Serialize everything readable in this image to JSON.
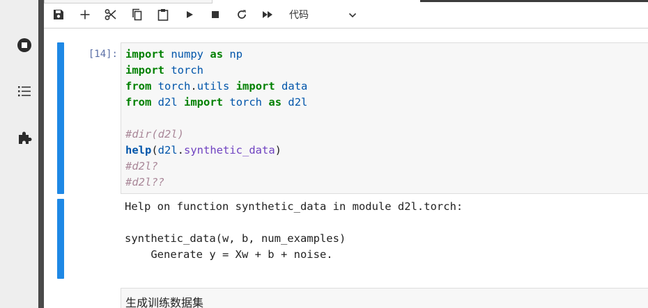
{
  "sidebar": {
    "items": [
      {
        "icon": "stop-circle-icon"
      },
      {
        "icon": "list-icon"
      },
      {
        "icon": "puzzle-piece-icon"
      }
    ]
  },
  "toolbar": {
    "buttons": [
      {
        "icon": "save-icon"
      },
      {
        "icon": "plus-icon"
      },
      {
        "icon": "scissors-icon"
      },
      {
        "icon": "copy-icon"
      },
      {
        "icon": "paste-icon"
      },
      {
        "icon": "run-icon"
      },
      {
        "icon": "stop-icon"
      },
      {
        "icon": "restart-icon"
      },
      {
        "icon": "fast-forward-icon"
      }
    ],
    "cell_type": "代码"
  },
  "cell": {
    "prompt": "[14]:",
    "code_lines": [
      [
        [
          "kw",
          "import"
        ],
        [
          "pl",
          " "
        ],
        [
          "nm",
          "numpy"
        ],
        [
          "pl",
          " "
        ],
        [
          "kw",
          "as"
        ],
        [
          "pl",
          " "
        ],
        [
          "nm",
          "np"
        ]
      ],
      [
        [
          "kw",
          "import"
        ],
        [
          "pl",
          " "
        ],
        [
          "nm",
          "torch"
        ]
      ],
      [
        [
          "kw",
          "from"
        ],
        [
          "pl",
          " "
        ],
        [
          "nm",
          "torch"
        ],
        [
          "pl",
          "."
        ],
        [
          "nm",
          "utils"
        ],
        [
          "pl",
          " "
        ],
        [
          "kw",
          "import"
        ],
        [
          "pl",
          " "
        ],
        [
          "nm",
          "data"
        ]
      ],
      [
        [
          "kw",
          "from"
        ],
        [
          "pl",
          " "
        ],
        [
          "nm",
          "d2l"
        ],
        [
          "pl",
          " "
        ],
        [
          "kw",
          "import"
        ],
        [
          "pl",
          " "
        ],
        [
          "nm",
          "torch"
        ],
        [
          "pl",
          " "
        ],
        [
          "kw",
          "as"
        ],
        [
          "pl",
          " "
        ],
        [
          "nm",
          "d2l"
        ]
      ],
      [],
      [
        [
          "cm",
          "#dir(d2l)"
        ]
      ],
      [
        [
          "fn",
          "help"
        ],
        [
          "pl",
          "("
        ],
        [
          "nm",
          "d2l"
        ],
        [
          "pl",
          "."
        ],
        [
          "attr",
          "synthetic_data"
        ],
        [
          "pl",
          ")"
        ]
      ],
      [
        [
          "cm",
          "#d2l?"
        ]
      ],
      [
        [
          "cm",
          "#d2l??"
        ]
      ]
    ],
    "output_lines": [
      "Help on function synthetic_data in module d2l.torch:",
      "",
      "synthetic_data(w, b, num_examples)",
      "    Generate y = Xw + b + noise."
    ]
  },
  "markdown_cell": {
    "text": "生成训练数据集"
  },
  "colors": {
    "accent": "#1e88e5",
    "keyword": "#008000",
    "name": "#0055aa",
    "comment": "#aa8899"
  }
}
